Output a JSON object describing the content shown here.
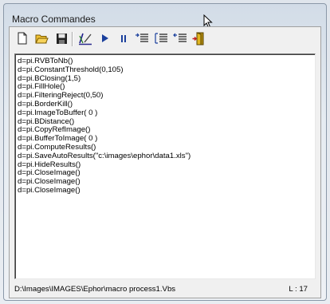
{
  "window": {
    "title": "Macro Commandes"
  },
  "toolbar": {
    "buttons": [
      {
        "name": "new-file-icon"
      },
      {
        "name": "open-folder-icon"
      },
      {
        "name": "save-disk-icon"
      },
      {
        "name": "edit-macro-icon"
      },
      {
        "name": "play-icon"
      },
      {
        "name": "pause-icon"
      },
      {
        "name": "indent-list-icon"
      },
      {
        "name": "outdent-list-icon"
      },
      {
        "name": "insert-list-icon"
      },
      {
        "name": "exit-door-icon"
      }
    ]
  },
  "editor": {
    "lines": [
      "d=pi.RVBToNb()",
      "d=pi.ConstantThreshold(0,105)",
      "d=pi.BClosing(1,5)",
      "d=pi.FillHole()",
      "d=pi.FilteringReject(0,50)",
      "d=pi.BorderKill()",
      "d=pi.ImageToBuffer( 0 )",
      "d=pi.BDistance()",
      "d=pi.CopyRefImage()",
      "d=pi.BufferToImage( 0 )",
      "d=pi.ComputeResults()",
      "d=pi.SaveAutoResults(\"c:\\images\\ephor\\data1.xls\")",
      "d=pi.HideResults()",
      "d=pi.CloseImage()",
      "d=pi.CloseImage()",
      "d=pi.CloseImage()"
    ]
  },
  "status": {
    "path": "D:\\Images\\IMAGES\\Ephor\\macro process1.Vbs",
    "line": "L : 17"
  },
  "colors": {
    "play": "#1a3f9c",
    "folder": "#e8b21a",
    "exit": "#c8a010"
  }
}
